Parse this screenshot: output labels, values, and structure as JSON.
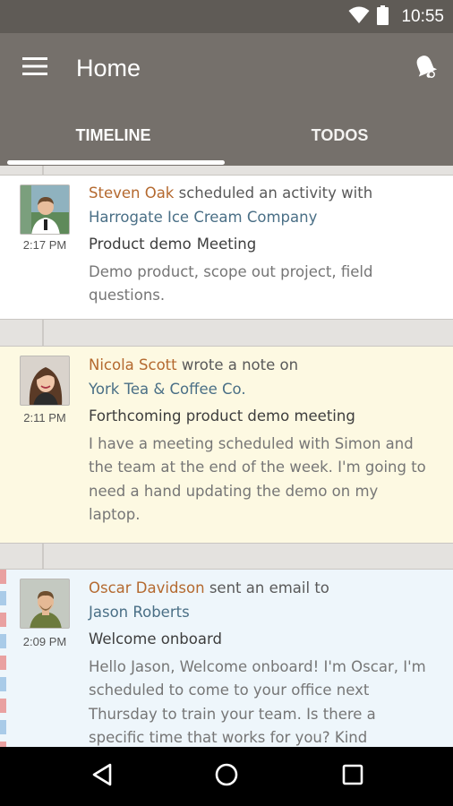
{
  "status_bar": {
    "time": "10:55"
  },
  "app_bar": {
    "title": "Home",
    "tabs": [
      {
        "label": "TIMELINE",
        "active": true
      },
      {
        "label": "TODOS",
        "active": false
      }
    ]
  },
  "timeline": [
    {
      "user": "Steven Oak",
      "action": " scheduled an activity with",
      "target": "Harrogate Ice Cream Company",
      "time": "2:17 PM",
      "subject": "Product demo",
      "subject_kind": "Meeting",
      "body": "Demo product, scope out project, field questions."
    },
    {
      "user": "Nicola Scott",
      "action": " wrote a note on",
      "target": "York Tea & Coffee Co.",
      "time": "2:11 PM",
      "subject": "Forthcoming product demo meeting",
      "body": "I have a meeting scheduled with Simon and the team at the end of the week. I'm going to need a hand updating the demo on my laptop."
    },
    {
      "user": "Oscar Davidson",
      "action": " sent an email to",
      "target": "Jason Roberts",
      "time": "2:09 PM",
      "subject": "Welcome onboard",
      "body": "Hello Jason, Welcome onboard! I'm Oscar, I'm scheduled to come to your office next Thursday to train your team. Is there a specific time that works for you? Kind"
    }
  ],
  "colors": {
    "app_bar": "#75706b",
    "status_bar": "#5f5b56",
    "user_name": "#b4692f",
    "target_name": "#4a6f86",
    "note_background": "#fdf9e2",
    "email_background": "#eef6fb"
  },
  "icons": [
    "wifi-icon",
    "battery-icon",
    "menu-icon",
    "notification-bell-icon",
    "back-icon",
    "home-icon",
    "recents-icon"
  ]
}
